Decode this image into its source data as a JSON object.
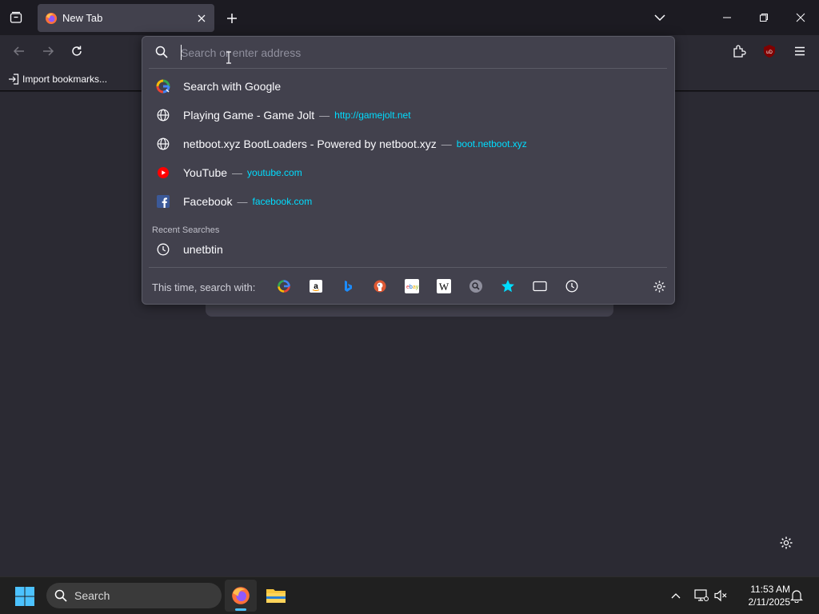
{
  "tab": {
    "title": "New Tab"
  },
  "bookmarks": {
    "import_label": "Import bookmarks..."
  },
  "urlbar": {
    "placeholder": "Search or enter address",
    "suggestions": [
      {
        "title": "Search with Google",
        "url": "",
        "icon": "google-icon"
      },
      {
        "title": "Playing Game - Game Jolt",
        "url": "http://gamejolt.net",
        "icon": "globe-icon"
      },
      {
        "title": "netboot.xyz BootLoaders - Powered by netboot.xyz",
        "url": "boot.netboot.xyz",
        "icon": "globe-icon"
      },
      {
        "title": "YouTube",
        "url": "youtube.com",
        "icon": "youtube-icon"
      },
      {
        "title": "Facebook",
        "url": "facebook.com",
        "icon": "facebook-icon"
      }
    ],
    "dash": "—",
    "recent_label": "Recent Searches",
    "recent": [
      {
        "title": "unetbtin",
        "icon": "history-icon"
      }
    ],
    "oneoff_label": "This time, search with:",
    "engines": [
      "google-icon",
      "amazon-icon",
      "bing-icon",
      "duckduckgo-icon",
      "ebay-icon",
      "wikipedia-icon",
      "search-engine-icon",
      "bookmarks-star-icon",
      "tabs-icon",
      "history-icon"
    ]
  },
  "taskbar": {
    "search_label": "Search",
    "time": "11:53 AM",
    "date": "2/11/2025"
  },
  "colors": {
    "accent": "#00ddff",
    "taskbar_accent": "#4cc2ff"
  }
}
